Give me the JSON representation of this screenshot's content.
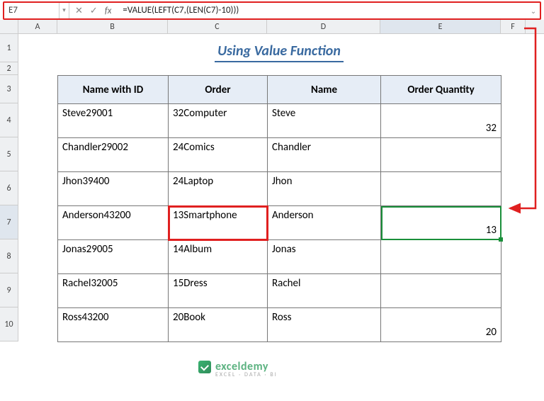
{
  "nameBox": "E7",
  "formula": "=VALUE(LEFT(C7,(LEN(C7)-10)))",
  "columns": [
    "A",
    "B",
    "C",
    "D",
    "E",
    "F"
  ],
  "rows": [
    "1",
    "2",
    "3",
    "4",
    "5",
    "6",
    "7",
    "8",
    "9",
    "10"
  ],
  "title": "Using Value Function",
  "headers": {
    "b": "Name with ID",
    "c": "Order",
    "d": "Name",
    "e": "Order Quantity"
  },
  "data": [
    {
      "b": "Steve29001",
      "c": "32Computer",
      "d": "Steve",
      "e": "32"
    },
    {
      "b": "Chandler29002",
      "c": "24Comics",
      "d": "Chandler",
      "e": ""
    },
    {
      "b": "Jhon39400",
      "c": "24Laptop",
      "d": "Jhon",
      "e": ""
    },
    {
      "b": "Anderson43200",
      "c": "13Smartphone",
      "d": "Anderson",
      "e": "13"
    },
    {
      "b": "Jonas29005",
      "c": "14Album",
      "d": "Jonas",
      "e": ""
    },
    {
      "b": "Rachel32005",
      "c": "15Dress",
      "d": "Rachel",
      "e": ""
    },
    {
      "b": "Ross43200",
      "c": "20Book",
      "d": "Ross",
      "e": "20"
    }
  ],
  "watermark": {
    "brand": "exceldemy",
    "tagline": "EXCEL · DATA · BI"
  },
  "icons": {
    "dropdown": "▾",
    "cancel": "✕",
    "confirm": "✓",
    "fx": "fx",
    "expand": "⌄"
  }
}
